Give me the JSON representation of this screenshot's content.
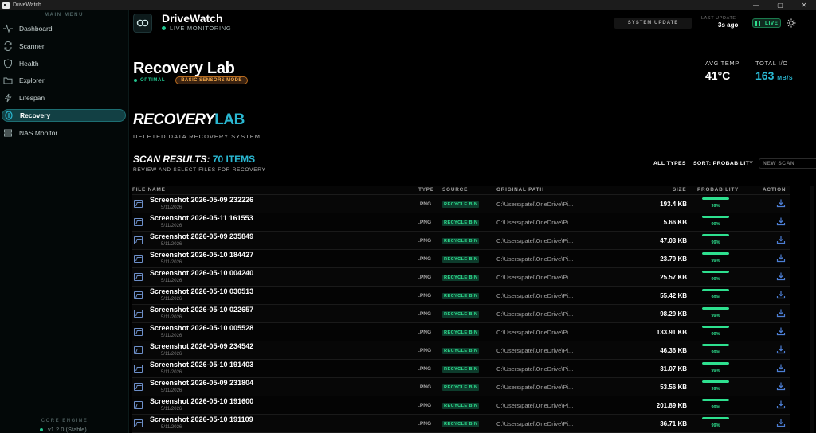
{
  "window": {
    "title": "DriveWatch",
    "controls": [
      "—",
      "▢",
      "✕"
    ]
  },
  "sidebar": {
    "menu_heading": "MAIN MENU",
    "items": [
      {
        "label": "Dashboard",
        "icon": "pulse-icon",
        "active": false
      },
      {
        "label": "Scanner",
        "icon": "refresh-icon",
        "active": false
      },
      {
        "label": "Health",
        "icon": "shield-icon",
        "active": false
      },
      {
        "label": "Explorer",
        "icon": "folder-icon",
        "active": false
      },
      {
        "label": "Lifespan",
        "icon": "bolt-icon",
        "active": false
      },
      {
        "label": "Recovery",
        "icon": "recovery-icon",
        "active": true
      },
      {
        "label": "NAS Monitor",
        "icon": "server-icon",
        "active": false
      }
    ],
    "core_engine_label": "CORE ENGINE",
    "version": "v1.2.0 (Stable)"
  },
  "header": {
    "brand": "DriveWatch",
    "status": "LIVE MONITORING",
    "system_update": "SYSTEM UPDATE",
    "last_update_label": "LAST UPDATE",
    "last_update_value": "3s ago",
    "live_label": "LIVE"
  },
  "page": {
    "title": "Recovery Lab",
    "status": "OPTIMAL",
    "mode_badge": "BASIC SENSORS MODE",
    "avg_temp_label": "AVG TEMP",
    "avg_temp_value": "41°C",
    "total_io_label": "TOTAL I/O",
    "total_io_value": "163",
    "total_io_unit": "MB/S",
    "section_title_a": "RECOVERY",
    "section_title_b": "LAB",
    "section_subtitle": "DELETED DATA RECOVERY SYSTEM",
    "scan_title_a": "SCAN RESULTS:",
    "scan_title_b": "70 ITEMS",
    "scan_subtitle": "REVIEW AND SELECT FILES FOR RECOVERY",
    "filter_types": "ALL TYPES",
    "sort_label": "SORT: PROBABILITY",
    "new_scan": "NEW SCAN"
  },
  "table": {
    "columns": [
      "FILE NAME",
      "TYPE",
      "SOURCE",
      "ORIGINAL PATH",
      "SIZE",
      "PROBABILITY",
      "ACTION"
    ],
    "rows": [
      {
        "name": "Screenshot 2026-05-09 232226",
        "date": "5/11/2026",
        "type": ".PNG",
        "source": "RECYCLE BIN",
        "path": "C:\\Users\\patel\\OneDrive\\Pi...",
        "size": "193.4 KB",
        "probability": 99,
        "probability_label": "99%"
      },
      {
        "name": "Screenshot 2026-05-11 161553",
        "date": "5/11/2026",
        "type": ".PNG",
        "source": "RECYCLE BIN",
        "path": "C:\\Users\\patel\\OneDrive\\Pi...",
        "size": "5.66 KB",
        "probability": 99,
        "probability_label": "99%"
      },
      {
        "name": "Screenshot 2026-05-09 235849",
        "date": "5/11/2026",
        "type": ".PNG",
        "source": "RECYCLE BIN",
        "path": "C:\\Users\\patel\\OneDrive\\Pi...",
        "size": "47.03 KB",
        "probability": 99,
        "probability_label": "99%"
      },
      {
        "name": "Screenshot 2026-05-10 184427",
        "date": "5/11/2026",
        "type": ".PNG",
        "source": "RECYCLE BIN",
        "path": "C:\\Users\\patel\\OneDrive\\Pi...",
        "size": "23.79 KB",
        "probability": 99,
        "probability_label": "99%"
      },
      {
        "name": "Screenshot 2026-05-10 004240",
        "date": "5/11/2026",
        "type": ".PNG",
        "source": "RECYCLE BIN",
        "path": "C:\\Users\\patel\\OneDrive\\Pi...",
        "size": "25.57 KB",
        "probability": 99,
        "probability_label": "99%"
      },
      {
        "name": "Screenshot 2026-05-10 030513",
        "date": "5/11/2026",
        "type": ".PNG",
        "source": "RECYCLE BIN",
        "path": "C:\\Users\\patel\\OneDrive\\Pi...",
        "size": "55.42 KB",
        "probability": 99,
        "probability_label": "99%"
      },
      {
        "name": "Screenshot 2026-05-10 022657",
        "date": "5/11/2026",
        "type": ".PNG",
        "source": "RECYCLE BIN",
        "path": "C:\\Users\\patel\\OneDrive\\Pi...",
        "size": "98.29 KB",
        "probability": 99,
        "probability_label": "99%"
      },
      {
        "name": "Screenshot 2026-05-10 005528",
        "date": "5/11/2026",
        "type": ".PNG",
        "source": "RECYCLE BIN",
        "path": "C:\\Users\\patel\\OneDrive\\Pi...",
        "size": "133.91 KB",
        "probability": 99,
        "probability_label": "99%"
      },
      {
        "name": "Screenshot 2026-05-09 234542",
        "date": "5/11/2026",
        "type": ".PNG",
        "source": "RECYCLE BIN",
        "path": "C:\\Users\\patel\\OneDrive\\Pi...",
        "size": "46.36 KB",
        "probability": 99,
        "probability_label": "99%"
      },
      {
        "name": "Screenshot 2026-05-10 191403",
        "date": "5/11/2026",
        "type": ".PNG",
        "source": "RECYCLE BIN",
        "path": "C:\\Users\\patel\\OneDrive\\Pi...",
        "size": "31.07 KB",
        "probability": 99,
        "probability_label": "99%"
      },
      {
        "name": "Screenshot 2026-05-09 231804",
        "date": "5/11/2026",
        "type": ".PNG",
        "source": "RECYCLE BIN",
        "path": "C:\\Users\\patel\\OneDrive\\Pi...",
        "size": "53.56 KB",
        "probability": 99,
        "probability_label": "99%"
      },
      {
        "name": "Screenshot 2026-05-10 191600",
        "date": "5/11/2026",
        "type": ".PNG",
        "source": "RECYCLE BIN",
        "path": "C:\\Users\\patel\\OneDrive\\Pi...",
        "size": "201.89 KB",
        "probability": 99,
        "probability_label": "99%"
      },
      {
        "name": "Screenshot 2026-05-10 191109",
        "date": "5/11/2026",
        "type": ".PNG",
        "source": "RECYCLE BIN",
        "path": "C:\\Users\\patel\\OneDrive\\Pi...",
        "size": "36.71 KB",
        "probability": 99,
        "probability_label": "99%"
      }
    ]
  },
  "colors": {
    "accent": "#2ab8d2",
    "success": "#2ee08f",
    "warning": "#f0a74a",
    "active_nav": "#124044",
    "file_icon": "#6d8fc9"
  }
}
